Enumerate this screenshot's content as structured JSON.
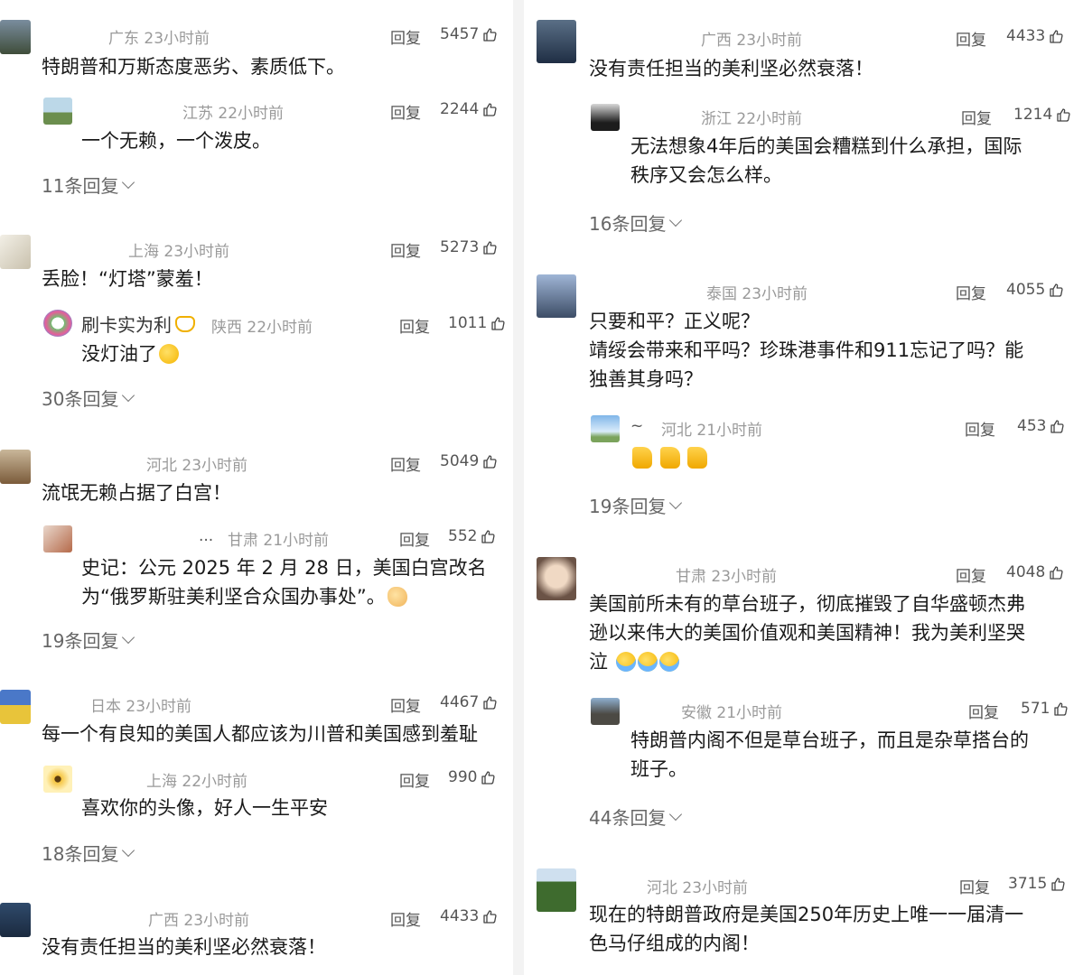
{
  "labels": {
    "reply": "回复"
  },
  "left": {
    "t1": {
      "meta": "广东 23小时前",
      "likes": "5457",
      "text": "特朗普和万斯态度恶劣、素质低下。",
      "sub": {
        "meta": "江苏 22小时前",
        "likes": "2244",
        "text": "一个无赖，一个泼皮。"
      },
      "more": "11条回复"
    },
    "t2": {
      "meta": "上海 23小时前",
      "likes": "5273",
      "text": "丢脸！“灯塔”蒙羞！",
      "sub": {
        "nick": "刷卡实为利",
        "meta": "陕西 22小时前",
        "likes": "1011",
        "text": "没灯油了"
      },
      "more": "30条回复"
    },
    "t3": {
      "meta": "河北 23小时前",
      "likes": "5049",
      "text": "流氓无赖占据了白宫！",
      "sub": {
        "nick": "...",
        "meta": "甘肃 21小时前",
        "likes": "552",
        "text1": "史记：公元 2025 年 2 月 28 日，美国白宫改名",
        "text2": "为“俄罗斯驻美利坚合众国办事处”。"
      },
      "more": "19条回复"
    },
    "t4": {
      "meta": "日本 23小时前",
      "likes": "4467",
      "text": "每一个有良知的美国人都应该为川普和美国感到羞耻",
      "sub": {
        "meta": "上海 22小时前",
        "likes": "990",
        "text": "喜欢你的头像，好人一生平安"
      },
      "more": "18条回复"
    },
    "t5": {
      "meta": "广西 23小时前",
      "likes": "4433",
      "text": "没有责任担当的美利坚必然衰落！"
    }
  },
  "right": {
    "t1": {
      "meta": "广西 23小时前",
      "likes": "4433",
      "text": "没有责任担当的美利坚必然衰落！",
      "sub": {
        "meta": "浙江 22小时前",
        "likes": "1214",
        "text1": "无法想象4年后的美国会糟糕到什么承担，国际",
        "text2": "秩序又会怎么样。"
      },
      "more": "16条回复"
    },
    "t2": {
      "meta": "泰国 23小时前",
      "likes": "4055",
      "text1": "只要和平？正义呢？",
      "text2": "靖绥会带来和平吗？珍珠港事件和911忘记了吗？能",
      "text3": "独善其身吗？",
      "sub": {
        "nick": "~",
        "meta": "河北 21小时前",
        "likes": "453"
      },
      "more": "19条回复"
    },
    "t3": {
      "meta": "甘肃 23小时前",
      "likes": "4048",
      "text1": "美国前所未有的草台班子，彻底摧毁了自华盛顿杰弗",
      "text2": "逊以来伟大的美国价值观和美国精神！我为美利坚哭",
      "text3": "泣",
      "sub": {
        "meta": "安徽 21小时前",
        "likes": "571",
        "text1": "特朗普内阁不但是草台班子，而且是杂草搭台的",
        "text2": "班子。"
      },
      "more": "44条回复"
    },
    "t4": {
      "meta": "河北 23小时前",
      "likes": "3715",
      "text1": "现在的特朗普政府是美国250年历史上唯一一届清一",
      "text2": "色马仔组成的内阁！"
    }
  },
  "colors": {
    "meta": "#9a9a9a",
    "text": "#1a1a1a",
    "divider": "#f3f3f3"
  },
  "icons": [
    "thumbs-up-icon",
    "chevron-down-icon",
    "avatar"
  ]
}
